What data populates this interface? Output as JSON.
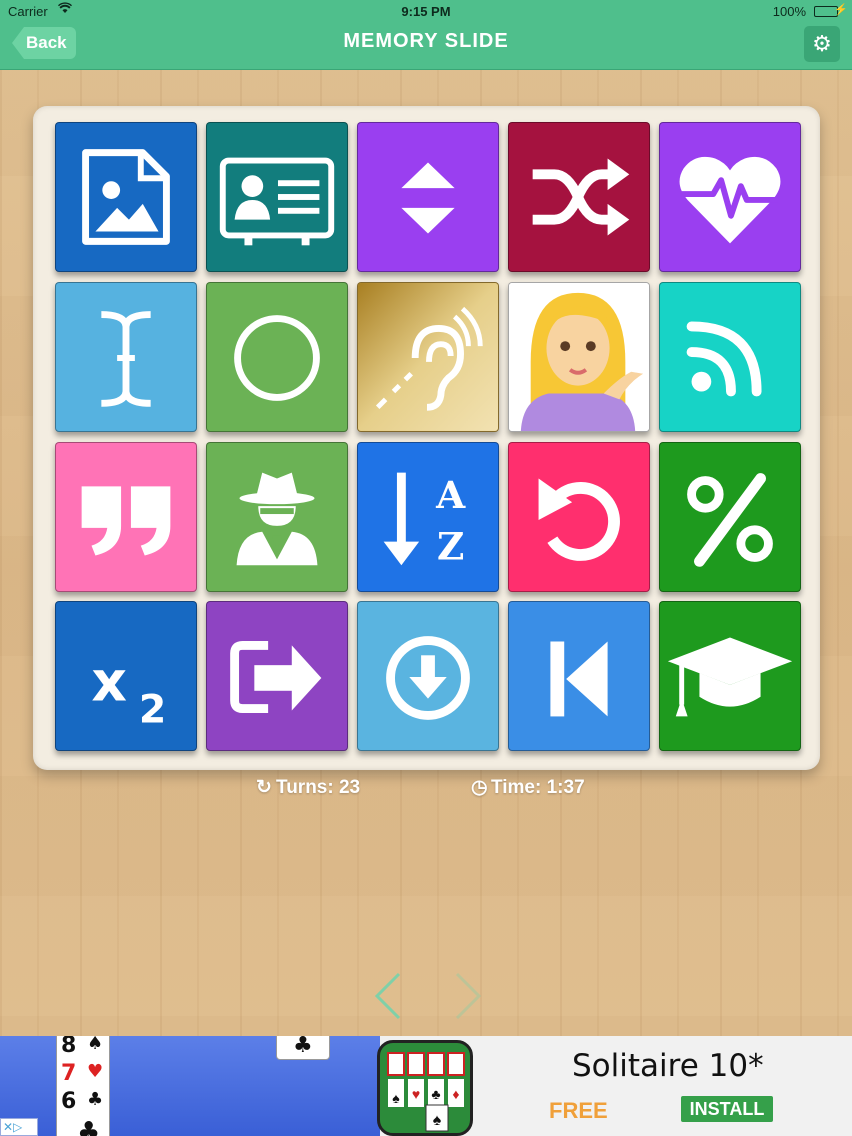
{
  "status_bar": {
    "carrier": "Carrier",
    "time": "9:15 PM",
    "battery": "100%"
  },
  "nav": {
    "back_label": "Back",
    "title": "MEMORY SLIDE",
    "settings_icon": "gear-icon"
  },
  "tiles": [
    {
      "icon": "file-image-icon",
      "color": "#1769c2"
    },
    {
      "icon": "id-card-icon",
      "color": "#127d7d"
    },
    {
      "icon": "sort-updown-icon",
      "color": "#9a3ff0"
    },
    {
      "icon": "shuffle-icon",
      "color": "#a5123f"
    },
    {
      "icon": "heartbeat-icon",
      "color": "#9a3ff0"
    },
    {
      "icon": "text-cursor-icon",
      "color": "#56b2e0"
    },
    {
      "icon": "circle-icon",
      "color": "#6bb255"
    },
    {
      "icon": "deaf-ear-icon",
      "color": "#c9a144"
    },
    {
      "icon": "woman-tipping-hand-emoji",
      "color": "#ffffff"
    },
    {
      "icon": "rss-icon",
      "color": "#17d3c6"
    },
    {
      "icon": "quote-right-icon",
      "color": "#ff73b6"
    },
    {
      "icon": "user-secret-icon",
      "color": "#6bb255"
    },
    {
      "icon": "sort-alpha-down-icon",
      "color": "#1f73e6"
    },
    {
      "icon": "undo-icon",
      "color": "#ff2f6e"
    },
    {
      "icon": "percent-icon",
      "color": "#1e9a1e"
    },
    {
      "icon": "subscript-icon",
      "color": "#1769c2"
    },
    {
      "icon": "sign-out-icon",
      "color": "#8e44c2"
    },
    {
      "icon": "download-circle-icon",
      "color": "#5ab4e0"
    },
    {
      "icon": "step-backward-icon",
      "color": "#3a8ee6"
    },
    {
      "icon": "graduation-cap-icon",
      "color": "#1e9a1e"
    }
  ],
  "stats": {
    "turns_label": "Turns: 23",
    "time_label": "Time: 1:37"
  },
  "pager": {
    "prev_icon": "chevron-left-icon",
    "next_icon": "chevron-right-icon"
  },
  "ad": {
    "app_name": "Solitaire 10*",
    "price": "FREE",
    "cta": "INSTALL",
    "card_ranks": [
      "8",
      "7",
      "6"
    ]
  }
}
